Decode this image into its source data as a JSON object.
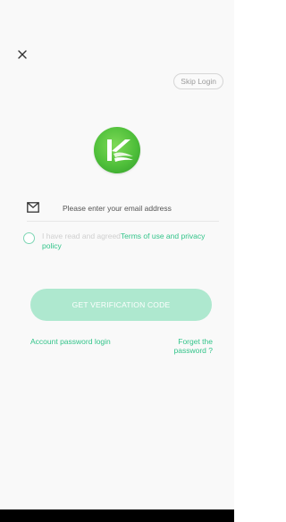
{
  "icons": {
    "close": "close-icon",
    "mail": "mail-icon",
    "logo": "app-logo-k"
  },
  "header": {
    "skip_label": "Skip Login"
  },
  "form": {
    "email_placeholder": "Please enter your email address",
    "agree_prefix": "I have read and agreed",
    "terms_link": "Terms of use and privacy policy",
    "submit_label": "GET VERIFICATION CODE"
  },
  "footer_links": {
    "account_login": "Account password login",
    "forget_password": "Forget the password ?"
  },
  "colors": {
    "accent": "#33c48a",
    "button_disabled": "#aee8cf",
    "logo_green": "#4fbf3a"
  }
}
